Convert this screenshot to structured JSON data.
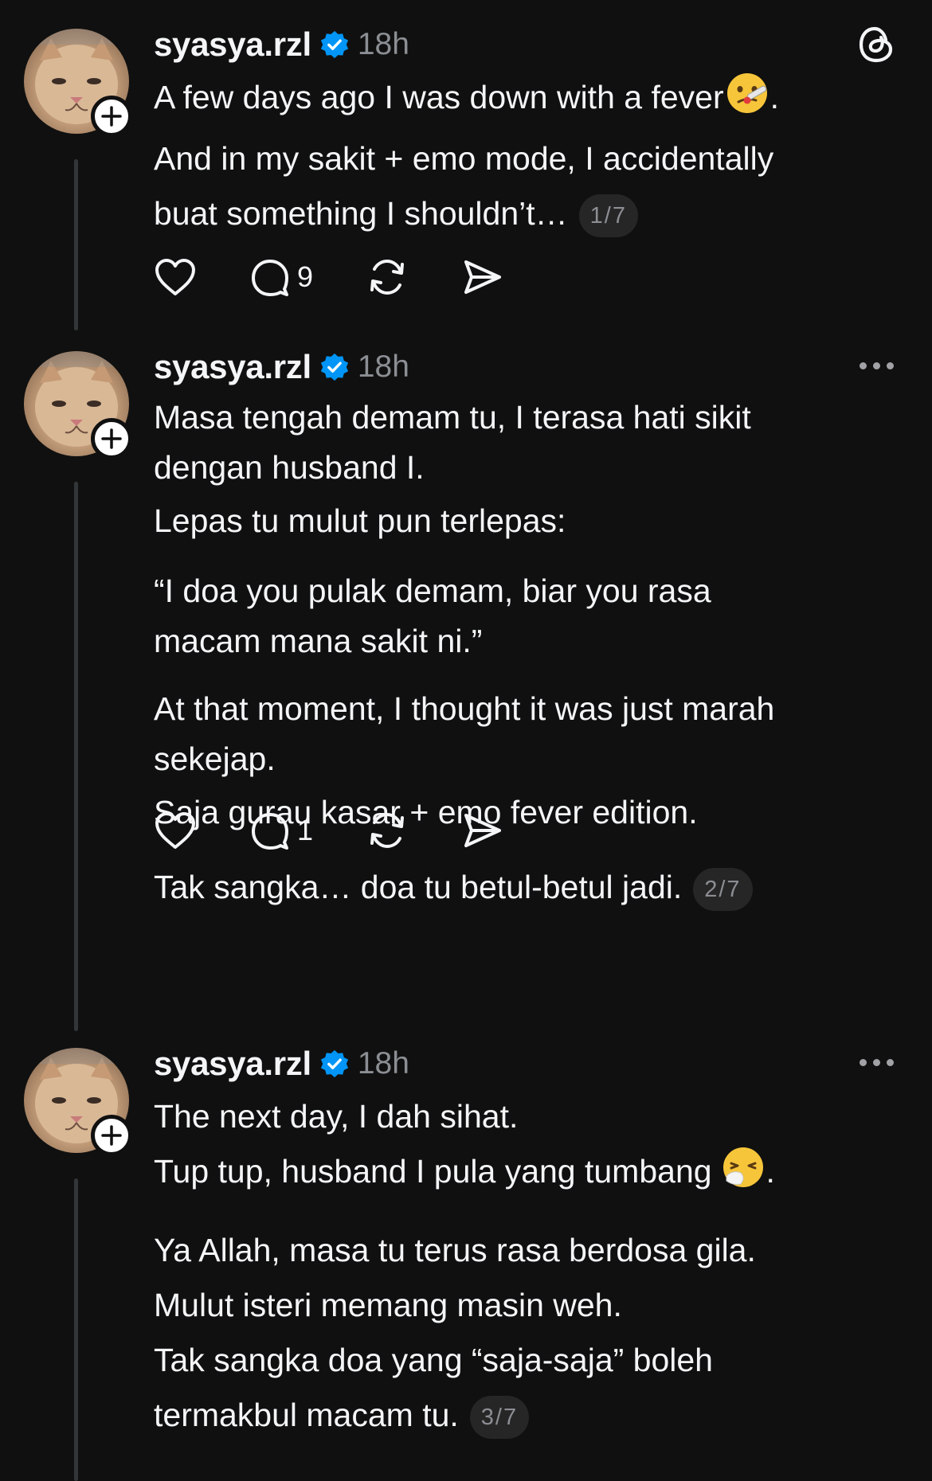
{
  "app": {
    "name": "Threads"
  },
  "posts": [
    {
      "username": "syasya.rzl",
      "time": "18h",
      "lines": [
        "A few days ago I was down with a fever",
        ".",
        "And in my sakit + emo mode, I accidentally",
        "buat something I shouldn’t…"
      ],
      "emoji": "face-with-thermometer-icon",
      "counter": "1/7",
      "reply_count": "9"
    },
    {
      "username": "syasya.rzl",
      "time": "18h",
      "lines": [
        "Masa tengah demam tu, I terasa hati sikit",
        "dengan husband I.",
        "Lepas tu mulut pun terlepas:",
        "“I doa you pulak demam, biar you rasa",
        "macam mana sakit ni.”",
        "At that moment, I thought it was just marah",
        "sekejap.",
        "Saja gurau kasar + emo fever edition.",
        "Tak sangka… doa tu betul-betul jadi."
      ],
      "counter": "2/7",
      "reply_count": "1"
    },
    {
      "username": "syasya.rzl",
      "time": "18h",
      "lines": [
        "The next day, I dah sihat.",
        "Tup tup, husband I pula yang tumbang",
        ".",
        "Ya Allah, masa tu terus rasa berdosa gila.",
        "Mulut isteri memang masin weh.",
        "Tak sangka doa yang “saja-saja” boleh",
        "termakbul macam tu."
      ],
      "emoji": "sneezing-face-icon",
      "counter": "3/7"
    }
  ],
  "colors": {
    "background": "#101010",
    "text": "#f3f5f7",
    "muted": "#8b8e93",
    "verified": "#0095f6",
    "thread_line": "#333638",
    "counter_bg": "#262626"
  }
}
